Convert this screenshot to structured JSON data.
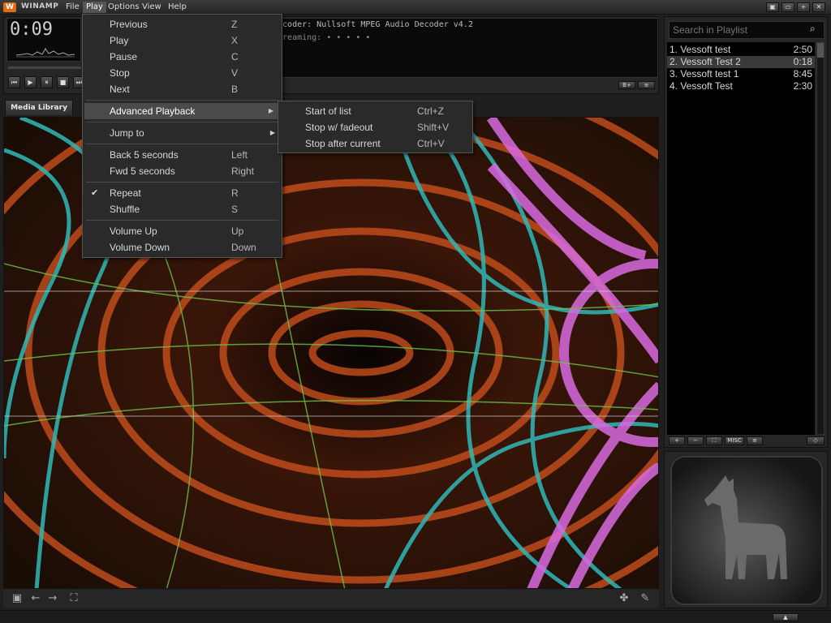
{
  "window": {
    "title": "WINAMP",
    "logo_glyph": "W"
  },
  "menubar": {
    "items": [
      "File",
      "Play",
      "Options",
      "View",
      "Help"
    ],
    "active": "Play"
  },
  "window_controls": [
    "▣",
    "▭",
    "+",
    "✕"
  ],
  "player": {
    "time": "0:09",
    "info_line1": "Decoder: Nullsoft MPEG Audio Decoder v4.2",
    "info_line2": "Streaming: • • • • •",
    "controls": [
      "⏮",
      "▶",
      "⏸",
      "■",
      "⏭"
    ],
    "small_buttons": [
      "B+",
      "≡"
    ]
  },
  "tabs": {
    "media_library": "Media Library"
  },
  "bottom_icons": [
    "monitor-icon",
    "back-arrow-icon",
    "forward-arrow-icon",
    "fullscreen-icon",
    "plugin-icon",
    "wrench-icon"
  ],
  "playlist": {
    "search_placeholder": "Search in Playlist",
    "items": [
      {
        "title": "1. Vessoft test",
        "duration": "2:50"
      },
      {
        "title": "2. Vessoft Test 2",
        "duration": "0:18"
      },
      {
        "title": "3. Vessoft test 1",
        "duration": "8:45"
      },
      {
        "title": "4. Vessoft Test",
        "duration": "2:30"
      }
    ],
    "selected_index": 1,
    "buttons": [
      "+",
      "−",
      "⛶",
      "MISC",
      "≡",
      "◇"
    ]
  },
  "play_menu": {
    "items": [
      {
        "label": "Previous",
        "shortcut": "Z"
      },
      {
        "label": "Play",
        "shortcut": "X"
      },
      {
        "label": "Pause",
        "shortcut": "C"
      },
      {
        "label": "Stop",
        "shortcut": "V"
      },
      {
        "label": "Next",
        "shortcut": "B"
      },
      {
        "label": "Advanced Playback",
        "shortcut": "",
        "submenu": true,
        "highlighted": true
      },
      {
        "label": "Jump to",
        "shortcut": "",
        "submenu": true
      },
      {
        "label": "Back 5 seconds",
        "shortcut": "Left"
      },
      {
        "label": "Fwd 5 seconds",
        "shortcut": "Right"
      },
      {
        "label": "Repeat",
        "shortcut": "R",
        "checked": true
      },
      {
        "label": "Shuffle",
        "shortcut": "S"
      },
      {
        "label": "Volume Up",
        "shortcut": "Up"
      },
      {
        "label": "Volume Down",
        "shortcut": "Down"
      }
    ]
  },
  "advanced_submenu": {
    "items": [
      {
        "label": "Start of list",
        "shortcut": "Ctrl+Z"
      },
      {
        "label": "Stop w/ fadeout",
        "shortcut": "Shift+V"
      },
      {
        "label": "Stop after current",
        "shortcut": "Ctrl+V"
      }
    ]
  },
  "status": {
    "button_label": "▲"
  },
  "colors": {
    "accent": "#e36a12",
    "menu_bg": "#2a2a2a",
    "menu_highlight": "#4a4a4a"
  }
}
